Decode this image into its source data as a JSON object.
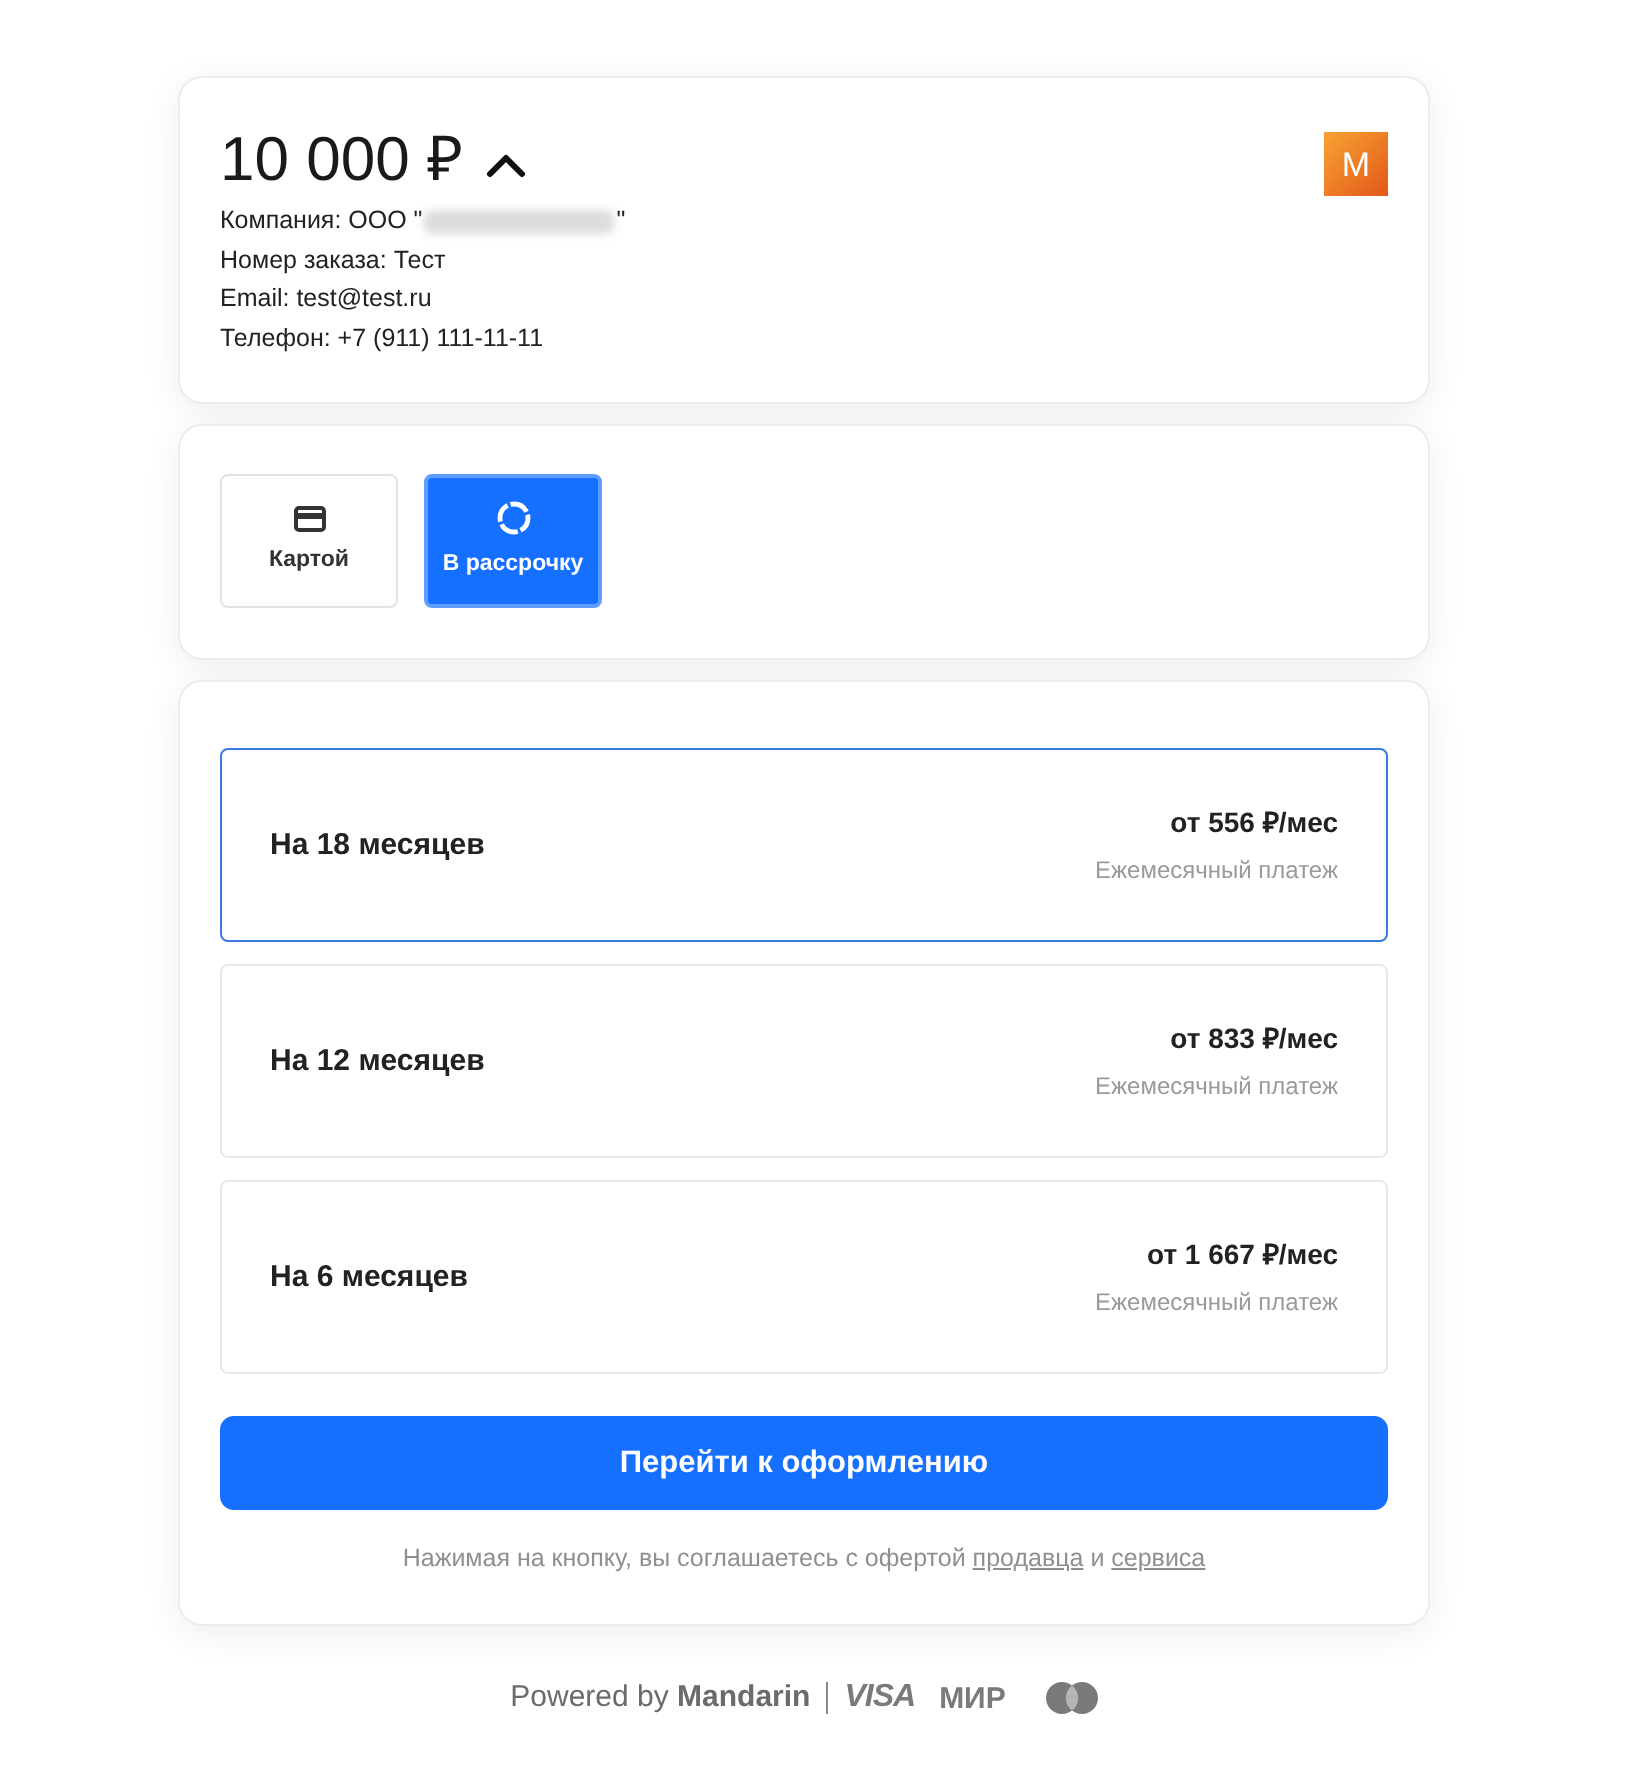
{
  "summary": {
    "amount": "10 000 ₽",
    "expanded": true,
    "logo_letter": "M",
    "company": {
      "prefix": "Компания: ООО \"",
      "suffix": "\"",
      "redacted": true
    },
    "details": [
      "Номер заказа: Тест",
      "Email: test@test.ru",
      "Телефон: +7 (911) 111-11-11"
    ]
  },
  "payment_methods": [
    {
      "label": "Картой",
      "kind": "card",
      "selected": false
    },
    {
      "label": "В рассрочку",
      "kind": "installment",
      "selected": true
    }
  ],
  "plans": [
    {
      "term": "На 18 месяцев",
      "price": "от 556 ₽/мес",
      "caption": "Ежемесячный платеж",
      "selected": true
    },
    {
      "term": "На 12 месяцев",
      "price": "от 833 ₽/мес",
      "caption": "Ежемесячный платеж",
      "selected": false
    },
    {
      "term": "На 6 месяцев",
      "price": "от 1 667 ₽/мес",
      "caption": "Ежемесячный платеж",
      "selected": false
    }
  ],
  "submit_button": "Перейти к оформлению",
  "consent": {
    "text": "Нажимая на кнопку, вы соглашаетесь с офертой",
    "joiner": "и",
    "links": [
      "продавца",
      "сервиса"
    ]
  },
  "footer": {
    "powered_by": "Powered by **Mandarin**",
    "brands": [
      {
        "kind": "visa",
        "label": "VISA"
      },
      {
        "kind": "mir",
        "label": "МИР"
      },
      {
        "kind": "mastercard"
      }
    ]
  }
}
